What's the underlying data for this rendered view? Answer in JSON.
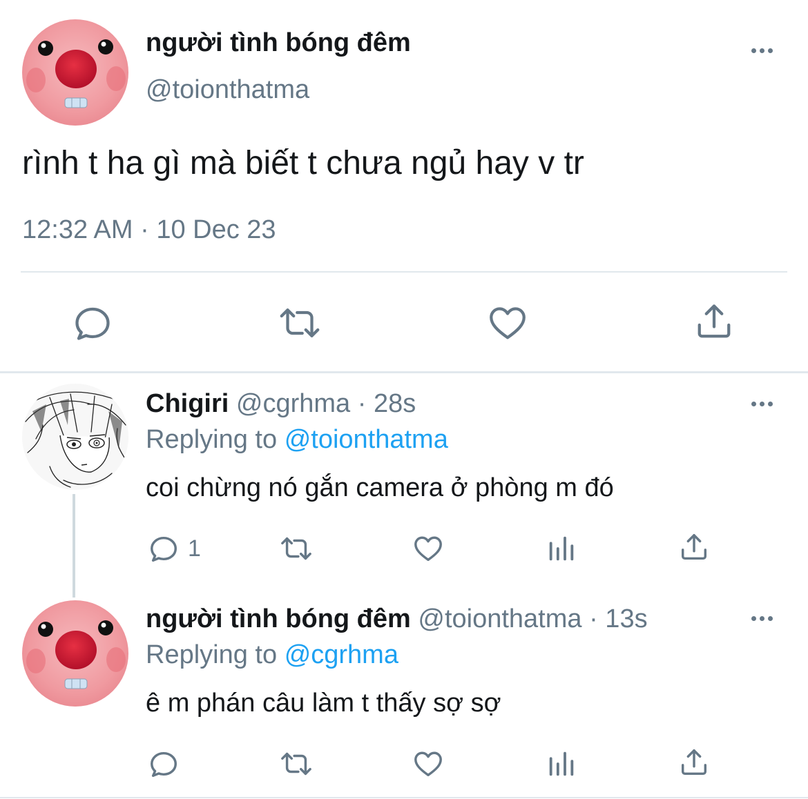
{
  "main_tweet": {
    "display_name": "người tình bóng đêm",
    "handle": "@toionthatma",
    "text": "rình t ha gì mà biết t chưa ngủ hay v tr",
    "timestamp": "12:32 AM · 10 Dec 23"
  },
  "replies": [
    {
      "display_name": "Chigiri",
      "handle": "@cgrhma",
      "time": "· 28s",
      "replying_label": "Replying to",
      "replying_to": "@toionthatma",
      "text": "coi chừng nó gắn camera ở phòng m đó",
      "reply_count": "1"
    },
    {
      "display_name": "người tình bóng đêm",
      "handle": "@toionthatma",
      "time": "· 13s",
      "replying_label": "Replying to",
      "replying_to": "@cgrhma",
      "text": "ê m phán câu làm t thấy sợ sợ",
      "reply_count": ""
    }
  ],
  "icons": {
    "reply": "reply-icon",
    "retweet": "retweet-icon",
    "like": "heart-icon",
    "views": "views-icon",
    "share": "share-icon",
    "more": "more-icon"
  },
  "colors": {
    "text": "#14171a",
    "muted": "#657786",
    "link": "#1da1f2",
    "divider": "#e1e8ed"
  }
}
